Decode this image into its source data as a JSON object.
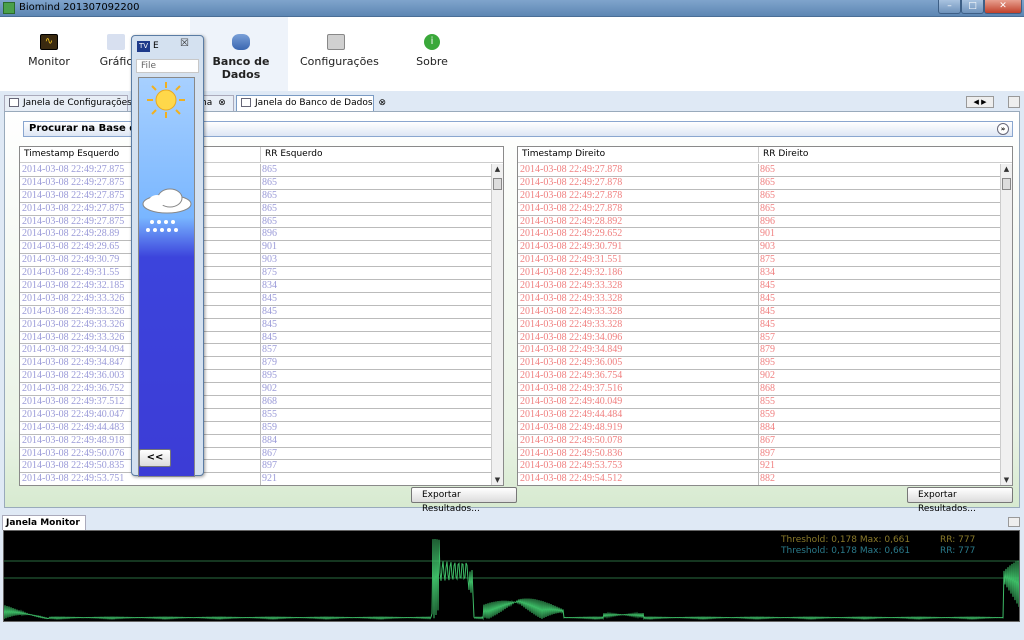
{
  "window": {
    "title": "Biomind 201307092200",
    "minimize": "–",
    "maximize": "□",
    "close": "✕"
  },
  "toolbar": {
    "items": [
      {
        "label": "Monitor",
        "icon": "monitor-icon"
      },
      {
        "label": "Gráfic",
        "icon": "chart-icon"
      },
      {
        "label": "Banco de Dados",
        "icon": "database-icon"
      },
      {
        "label": "Configurações",
        "icon": "settings-icon"
      },
      {
        "label": "Sobre",
        "icon": "info-icon"
      }
    ],
    "monitor_glyph": "∿",
    "sobre_glyph": "i"
  },
  "tabs": [
    {
      "label": "Janela de Configurações",
      "close": "⊗"
    },
    {
      "label": "ha",
      "close": "⊗"
    },
    {
      "label": "Janela do Banco de Dados",
      "close": "⊗"
    }
  ],
  "tabnav": "◀ ▶",
  "search": {
    "label": "Procurar na Base de Da",
    "toggle": "»"
  },
  "table_left": {
    "headers": [
      "Timestamp Esquerdo",
      "RR Esquerdo"
    ],
    "rows": [
      [
        "2014-03-08 22:49:27.875",
        "865"
      ],
      [
        "2014-03-08 22:49:27.875",
        "865"
      ],
      [
        "2014-03-08 22:49:27.875",
        "865"
      ],
      [
        "2014-03-08 22:49:27.875",
        "865"
      ],
      [
        "2014-03-08 22:49:27.875",
        "865"
      ],
      [
        "2014-03-08 22:49:28.89",
        "896"
      ],
      [
        "2014-03-08 22:49:29.65",
        "901"
      ],
      [
        "2014-03-08 22:49:30.79",
        "903"
      ],
      [
        "2014-03-08 22:49:31.55",
        "875"
      ],
      [
        "2014-03-08 22:49:32.185",
        "834"
      ],
      [
        "2014-03-08 22:49:33.326",
        "845"
      ],
      [
        "2014-03-08 22:49:33.326",
        "845"
      ],
      [
        "2014-03-08 22:49:33.326",
        "845"
      ],
      [
        "2014-03-08 22:49:33.326",
        "845"
      ],
      [
        "2014-03-08 22:49:34.094",
        "857"
      ],
      [
        "2014-03-08 22:49:34.847",
        "879"
      ],
      [
        "2014-03-08 22:49:36.003",
        "895"
      ],
      [
        "2014-03-08 22:49:36.752",
        "902"
      ],
      [
        "2014-03-08 22:49:37.512",
        "868"
      ],
      [
        "2014-03-08 22:49:40.047",
        "855"
      ],
      [
        "2014-03-08 22:49:44.483",
        "859"
      ],
      [
        "2014-03-08 22:49:48.918",
        "884"
      ],
      [
        "2014-03-08 22:49:50.076",
        "867"
      ],
      [
        "2014-03-08 22:49:50.835",
        "897"
      ],
      [
        "2014-03-08 22:49:53.751",
        "921"
      ]
    ]
  },
  "table_right": {
    "headers": [
      "Timestamp Direito",
      "RR Direito"
    ],
    "rows": [
      [
        "2014-03-08 22:49:27.878",
        "865"
      ],
      [
        "2014-03-08 22:49:27.878",
        "865"
      ],
      [
        "2014-03-08 22:49:27.878",
        "865"
      ],
      [
        "2014-03-08 22:49:27.878",
        "865"
      ],
      [
        "2014-03-08 22:49:28.892",
        "896"
      ],
      [
        "2014-03-08 22:49:29.652",
        "901"
      ],
      [
        "2014-03-08 22:49:30.791",
        "903"
      ],
      [
        "2014-03-08 22:49:31.551",
        "875"
      ],
      [
        "2014-03-08 22:49:32.186",
        "834"
      ],
      [
        "2014-03-08 22:49:33.328",
        "845"
      ],
      [
        "2014-03-08 22:49:33.328",
        "845"
      ],
      [
        "2014-03-08 22:49:33.328",
        "845"
      ],
      [
        "2014-03-08 22:49:33.328",
        "845"
      ],
      [
        "2014-03-08 22:49:34.096",
        "857"
      ],
      [
        "2014-03-08 22:49:34.849",
        "879"
      ],
      [
        "2014-03-08 22:49:36.005",
        "895"
      ],
      [
        "2014-03-08 22:49:36.754",
        "902"
      ],
      [
        "2014-03-08 22:49:37.516",
        "868"
      ],
      [
        "2014-03-08 22:49:40.049",
        "855"
      ],
      [
        "2014-03-08 22:49:44.484",
        "859"
      ],
      [
        "2014-03-08 22:49:48.919",
        "884"
      ],
      [
        "2014-03-08 22:49:50.078",
        "867"
      ],
      [
        "2014-03-08 22:49:50.836",
        "897"
      ],
      [
        "2014-03-08 22:49:53.753",
        "921"
      ],
      [
        "2014-03-08 22:49:54.512",
        "882"
      ]
    ]
  },
  "scroll": {
    "up": "▲",
    "down": "▼"
  },
  "export_label": "Exportar Resultados...",
  "monitor": {
    "tab_label": "Janela Monitor",
    "tab_close": "⊗",
    "line1": "Threshold: 0,178  Max: 0,661",
    "line1_rr": "RR: 777",
    "line2": "Threshold: 0,178  Max: 0,661",
    "line2_rr": "RR: 777",
    "colors": {
      "signal": "#3dbb66",
      "line1": "#8a7a2a",
      "line2": "#2a7a8a"
    }
  },
  "popup": {
    "title": "E",
    "close": "☒",
    "menu": "File",
    "back": "<<",
    "icons": [
      "sun-icon",
      "cloud-rain-icon"
    ]
  }
}
